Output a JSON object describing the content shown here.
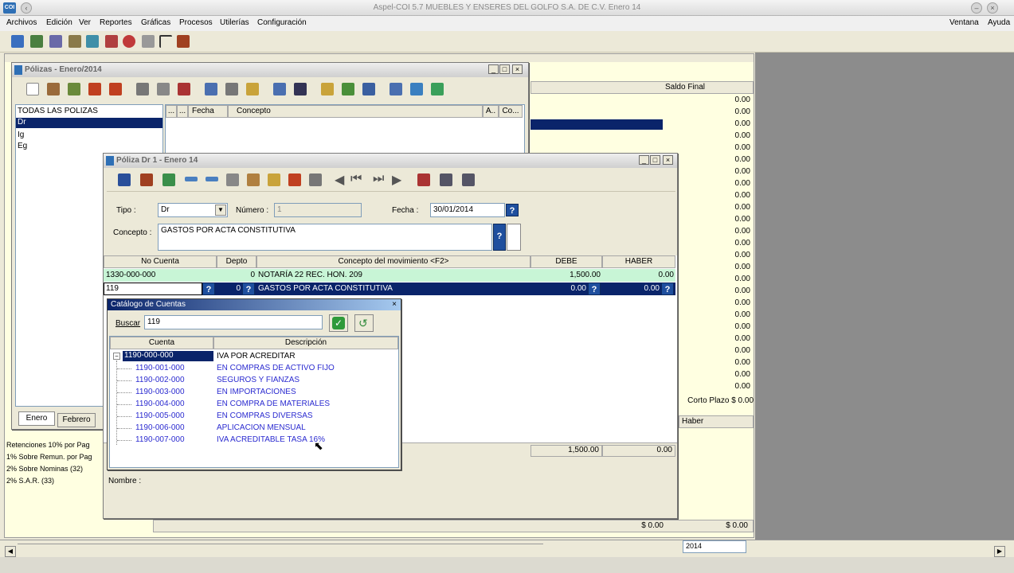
{
  "app": {
    "title": "Aspel-COI 5.7 MUEBLES Y ENSERES DEL GOLFO S.A. DE C.V.  Enero 14",
    "icon_label": "COI"
  },
  "menu": {
    "items": [
      "Archivos",
      "Edición",
      "Ver",
      "Reportes",
      "Gráficas",
      "Procesos",
      "Utilerías",
      "Configuración"
    ],
    "right": [
      "Ventana",
      "Ayuda"
    ]
  },
  "main": {
    "col_saldo_final": "Saldo Final",
    "saldos": [
      "0.00",
      "0.00",
      "0.00",
      "0.00",
      "0.00",
      "0.00",
      "0.00",
      "0.00",
      "0.00",
      "0.00",
      "0.00",
      "0.00",
      "0.00",
      "0.00",
      "0.00",
      "0.00",
      "0.00",
      "0.00",
      "0.00",
      "0.00",
      "0.00",
      "0.00",
      "0.00",
      "0.00",
      "0.00"
    ],
    "corto_plazo": "Corto Plazo  $ 0.00",
    "haber_lbl": "Haber",
    "bottom_total_1": "$ 0.00",
    "bottom_total_2": "$ 0.00",
    "year": "2014",
    "left_list": [
      "Retenciones 10% por Pag",
      "1% Sobre Remun. por Pag",
      "2% Sobre Nominas (32)",
      "2% S.A.R. (33)"
    ]
  },
  "polizas": {
    "title": "Pólizas - Enero/2014",
    "types": [
      "TODAS LAS POLIZAS",
      "Dr",
      "Ig",
      "Eg"
    ],
    "cols": [
      "...",
      "...",
      "Fecha",
      "Concepto",
      "A..",
      "Co..."
    ],
    "tabs": [
      "Enero",
      "Febrero"
    ]
  },
  "poliza": {
    "title": "Póliza Dr     1 - Enero 14",
    "tipo_label": "Tipo :",
    "tipo_value": "Dr",
    "numero_label": "Número :",
    "numero_value": "1",
    "fecha_label": "Fecha :",
    "fecha_value": "30/01/2014",
    "concepto_label": "Concepto :",
    "concepto_value": "GASTOS POR ACTA CONSTITUTIVA",
    "cols": [
      "No Cuenta",
      "Depto",
      "Concepto del movimiento <F2>",
      "DEBE",
      "HABER"
    ],
    "rows": [
      {
        "cuenta": "1330-000-000",
        "depto": "0",
        "concepto": "NOTARÍA 22 REC. HON. 209",
        "debe": "1,500.00",
        "haber": "0.00"
      },
      {
        "cuenta": "119",
        "depto": "0",
        "concepto": "GASTOS POR ACTA CONSTITUTIVA",
        "debe": "0.00",
        "haber": "0.00"
      }
    ],
    "total_debe": "1,500.00",
    "total_haber": "0.00",
    "nombre_label": "Nombre :"
  },
  "catalogo": {
    "title": "Catálogo de Cuentas",
    "buscar_label": "Buscar",
    "buscar_value": "119",
    "col_cuenta": "Cuenta",
    "col_descripcion": "Descripción",
    "items": [
      {
        "cuenta": "1190-000-000",
        "desc": "IVA POR ACREDITAR"
      },
      {
        "cuenta": "1190-001-000",
        "desc": "EN COMPRAS DE ACTIVO FIJO"
      },
      {
        "cuenta": "1190-002-000",
        "desc": "SEGUROS Y FIANZAS"
      },
      {
        "cuenta": "1190-003-000",
        "desc": "EN IMPORTACIONES"
      },
      {
        "cuenta": "1190-004-000",
        "desc": "EN COMPRA DE MATERIALES"
      },
      {
        "cuenta": "1190-005-000",
        "desc": "EN COMPRAS DIVERSAS"
      },
      {
        "cuenta": "1190-006-000",
        "desc": "APLICACION MENSUAL"
      },
      {
        "cuenta": "1190-007-000",
        "desc": "IVA ACREDITABLE TASA 16%"
      }
    ]
  },
  "colors": {
    "selection": "#0a246a",
    "accent_green": "#c8f5d6",
    "desktop": "#8c8c8c",
    "main_bg": "#ffffe1"
  }
}
